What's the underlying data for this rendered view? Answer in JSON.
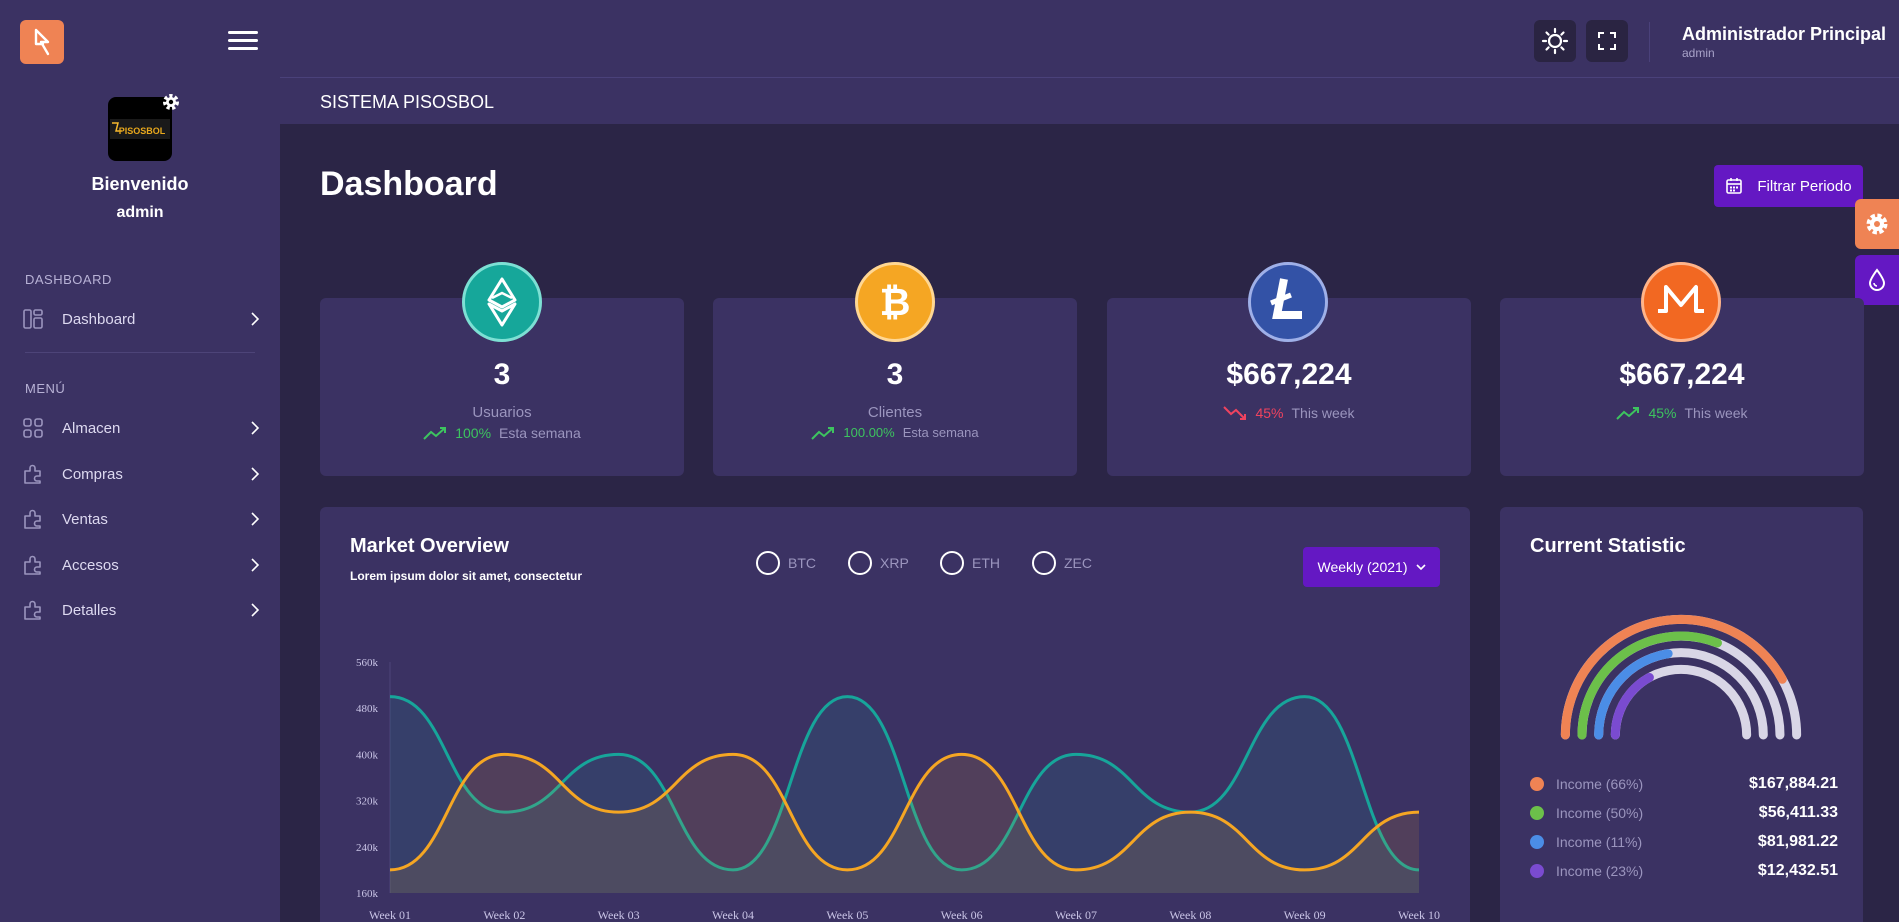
{
  "sidebar": {
    "avatar_label": "PISOSBOL",
    "welcome": "Bienvenido",
    "username": "admin",
    "section_dashboard": "DASHBOARD",
    "section_menu": "MENÚ",
    "items": [
      {
        "label": "Dashboard"
      },
      {
        "label": "Almacen"
      },
      {
        "label": "Compras"
      },
      {
        "label": "Ventas"
      },
      {
        "label": "Accesos"
      },
      {
        "label": "Detalles"
      }
    ]
  },
  "header": {
    "user_name": "Administrador Principal",
    "user_role": "admin",
    "system_title": "SISTEMA PISOSBOL"
  },
  "main": {
    "page_title": "Dashboard",
    "filter_label": "Filtrar Periodo"
  },
  "cards": [
    {
      "icon": "ethereum-classic-icon",
      "value": "3",
      "label": "Usuarios",
      "percent": "100%",
      "period": "Esta semana",
      "trend": "up",
      "color": "#16a79a"
    },
    {
      "icon": "bitcoin-icon",
      "value": "3",
      "label": "Clientes",
      "percent": "100.00%",
      "period": "Esta semana",
      "trend": "up",
      "color": "#f5a623"
    },
    {
      "icon": "litecoin-icon",
      "value": "$667,224",
      "percent": "45%",
      "period": "This week",
      "trend": "down",
      "color": "#3352a6"
    },
    {
      "icon": "monero-icon",
      "value": "$667,224",
      "percent": "45%",
      "period": "This week",
      "trend": "up",
      "color": "#f26822"
    }
  ],
  "market": {
    "title": "Market Overview",
    "subtitle": "Lorem ipsum dolor sit amet, consectetur",
    "options": [
      "BTC",
      "XRP",
      "ETH",
      "ZEC"
    ],
    "period_button": "Weekly (2021)"
  },
  "chart_data": {
    "type": "area",
    "x": [
      "Week 01",
      "Week 02",
      "Week 03",
      "Week 04",
      "Week 05",
      "Week 06",
      "Week 07",
      "Week 08",
      "Week 09",
      "Week 10"
    ],
    "yticks": [
      "160k",
      "240k",
      "320k",
      "400k",
      "480k",
      "560k"
    ],
    "ylim": [
      160,
      560
    ],
    "series": [
      {
        "color": "#17a59a",
        "values": [
          500,
          300,
          400,
          200,
          500,
          200,
          400,
          300,
          500,
          200
        ]
      },
      {
        "color": "#f5a623",
        "values": [
          200,
          400,
          300,
          400,
          200,
          400,
          200,
          300,
          200,
          300
        ]
      }
    ]
  },
  "statistic": {
    "title": "Current Statistic",
    "items": [
      {
        "label": "Income (66%)",
        "amount": "$167,884.21",
        "color": "#ef8354",
        "fraction": 0.66
      },
      {
        "label": "Income (50%)",
        "amount": "$56,411.33",
        "color": "#6cc04a",
        "fraction": 0.5
      },
      {
        "label": "Income (11%)",
        "amount": "$81,981.22",
        "color": "#4b8de6",
        "fraction": 0.11
      },
      {
        "label": "Income (23%)",
        "amount": "$12,432.51",
        "color": "#7a4bd0",
        "fraction": 0.23
      }
    ]
  }
}
